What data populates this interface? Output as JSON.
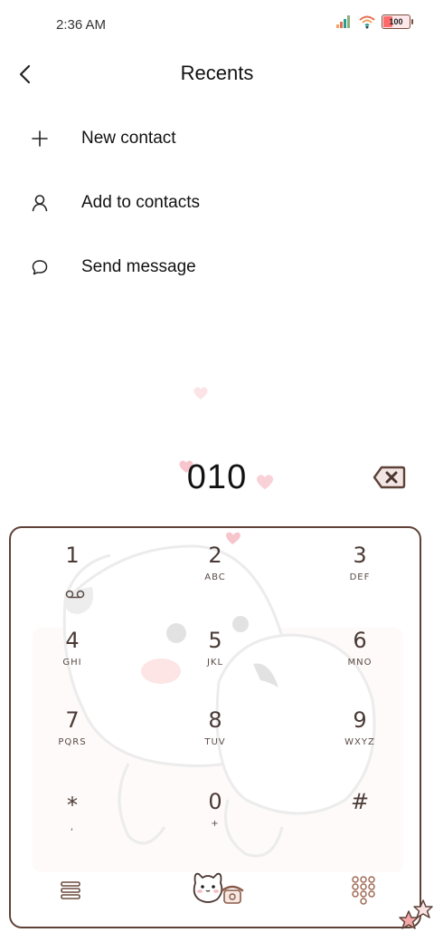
{
  "status_bar": {
    "time": "2:36 AM",
    "battery_level": "100",
    "icons": [
      "signal-icon",
      "wifi-icon",
      "battery-icon"
    ]
  },
  "header": {
    "title": "Recents",
    "back_icon": "back-arrow-icon"
  },
  "menu": {
    "items": [
      {
        "label": "New contact",
        "icon": "plus-icon"
      },
      {
        "label": "Add to contacts",
        "icon": "person-icon"
      },
      {
        "label": "Send message",
        "icon": "chat-bubble-icon"
      }
    ]
  },
  "dialer": {
    "number": "010",
    "delete_icon": "backspace-icon"
  },
  "keypad": {
    "keys": [
      {
        "digit": "1",
        "letters": "voicemail"
      },
      {
        "digit": "2",
        "letters": "ABC"
      },
      {
        "digit": "3",
        "letters": "DEF"
      },
      {
        "digit": "4",
        "letters": "GHI"
      },
      {
        "digit": "5",
        "letters": "JKL"
      },
      {
        "digit": "6",
        "letters": "MNO"
      },
      {
        "digit": "7",
        "letters": "PQRS"
      },
      {
        "digit": "8",
        "letters": "TUV"
      },
      {
        "digit": "9",
        "letters": "WXYZ"
      },
      {
        "digit": "*",
        "letters": ","
      },
      {
        "digit": "0",
        "letters": "+"
      },
      {
        "digit": "#",
        "letters": ""
      }
    ],
    "bottom": [
      "menu-icon",
      "call-button-icon",
      "keypad-toggle-icon"
    ]
  },
  "colors": {
    "accent_brown": "#5e4238",
    "heart_pink": "#f7c5cc",
    "text": "#111111"
  }
}
